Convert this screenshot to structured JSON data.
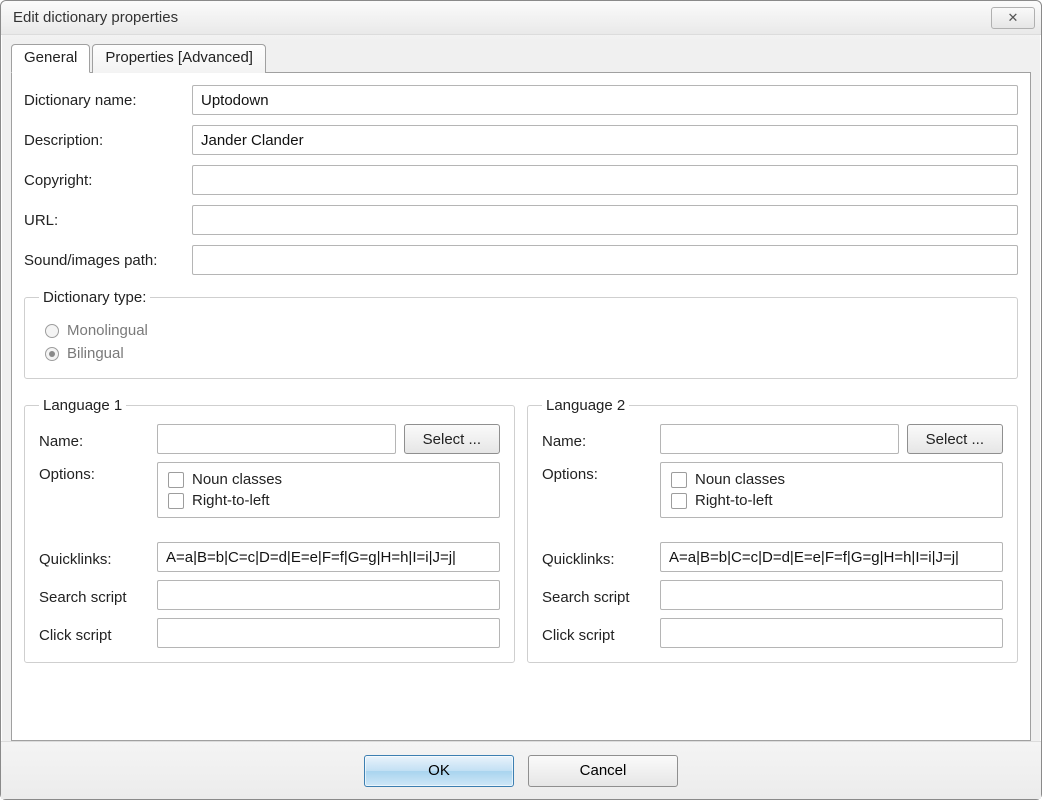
{
  "window": {
    "title": "Edit dictionary properties"
  },
  "tabs": {
    "general": "General",
    "advanced": "Properties [Advanced]"
  },
  "fields": {
    "dict_name_label": "Dictionary name:",
    "dict_name_value": "Uptodown",
    "description_label": "Description:",
    "description_value": "Jander Clander",
    "copyright_label": "Copyright:",
    "copyright_value": "",
    "url_label": "URL:",
    "url_value": "",
    "sound_path_label": "Sound/images path:",
    "sound_path_value": ""
  },
  "dict_type": {
    "legend": "Dictionary type:",
    "monolingual": "Monolingual",
    "bilingual": "Bilingual",
    "selected": "bilingual"
  },
  "lang_common": {
    "name_label": "Name:",
    "options_label": "Options:",
    "quicklinks_label": "Quicklinks:",
    "search_script_label": "Search script",
    "click_script_label": "Click script",
    "select_button": "Select ...",
    "noun_classes": "Noun classes",
    "rtl": "Right-to-left"
  },
  "lang1": {
    "legend": "Language 1",
    "name_value": "",
    "quicklinks_value": "A=a|B=b|C=c|D=d|E=e|F=f|G=g|H=h|I=i|J=j|",
    "search_script_value": "",
    "click_script_value": ""
  },
  "lang2": {
    "legend": "Language 2",
    "name_value": "",
    "quicklinks_value": "A=a|B=b|C=c|D=d|E=e|F=f|G=g|H=h|I=i|J=j|",
    "search_script_value": "",
    "click_script_value": ""
  },
  "footer": {
    "ok": "OK",
    "cancel": "Cancel"
  }
}
